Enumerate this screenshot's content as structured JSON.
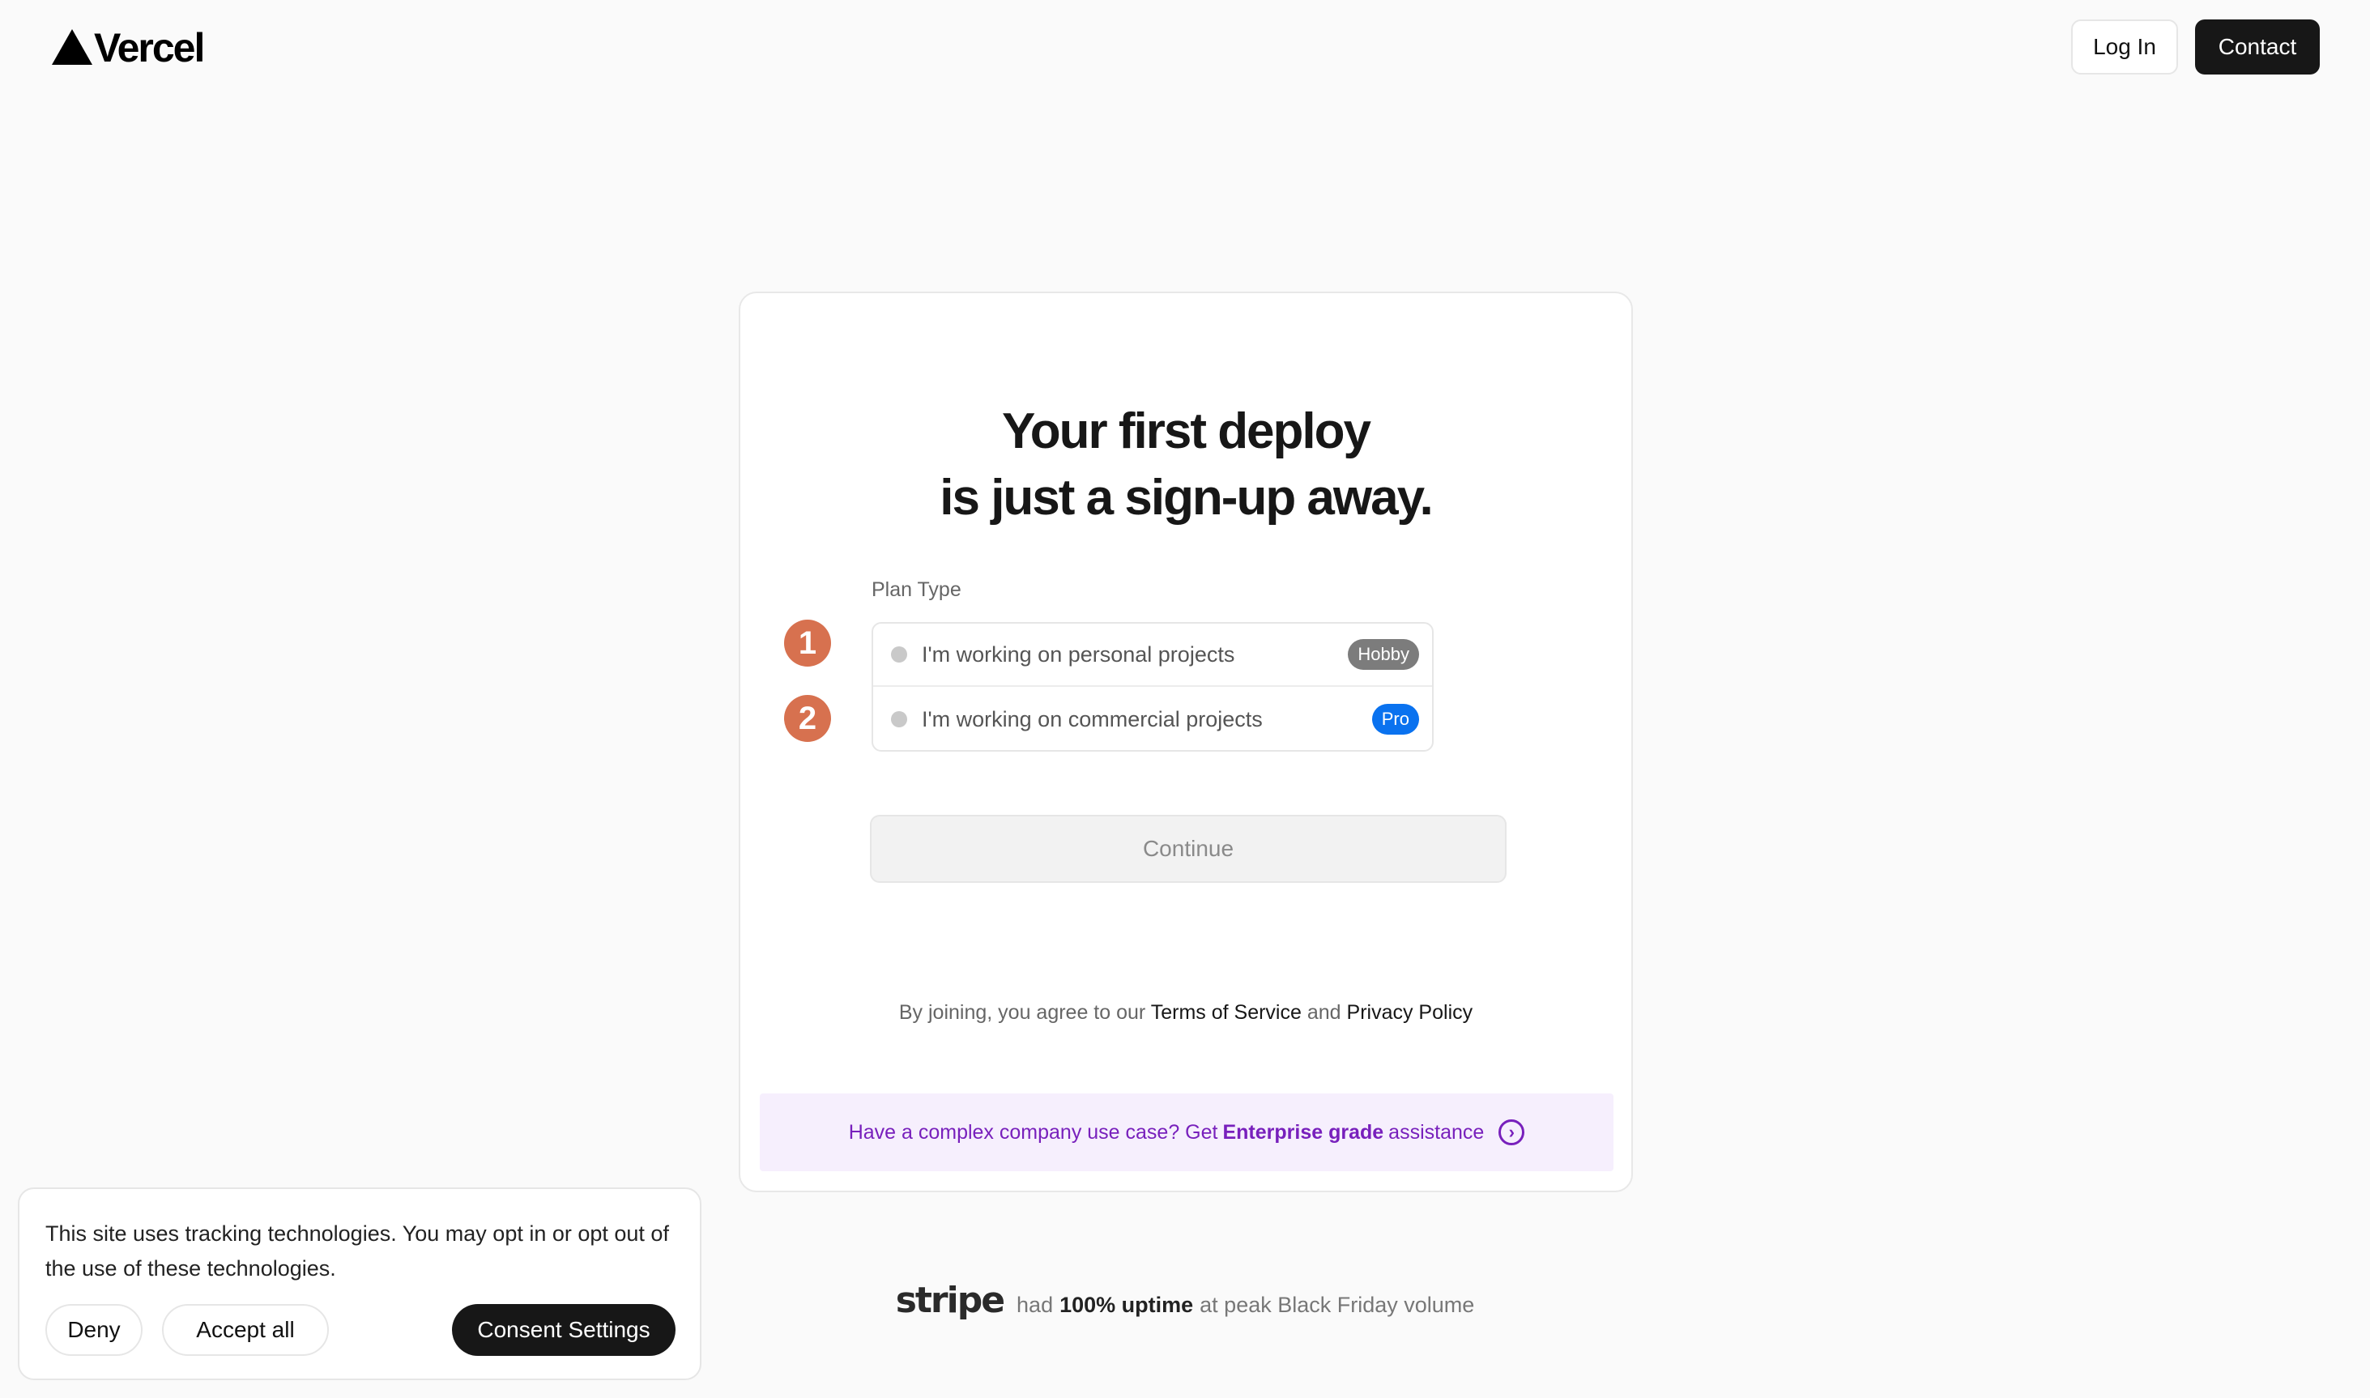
{
  "header": {
    "logo_text": "Vercel",
    "login_label": "Log In",
    "contact_label": "Contact"
  },
  "signup": {
    "headline_line1": "Your first deploy",
    "headline_line2": "is just a sign-up away.",
    "plan_label": "Plan Type",
    "options": [
      {
        "step": "1",
        "text": "I'm working on personal projects",
        "badge": "Hobby"
      },
      {
        "step": "2",
        "text": "I'm working on commercial projects",
        "badge": "Pro"
      }
    ],
    "continue_label": "Continue",
    "legal_prefix": "By joining, you agree to our",
    "terms_label": "Terms of Service",
    "legal_and": "and",
    "privacy_label": "Privacy Policy",
    "enterprise_prefix": "Have a complex company use case? Get",
    "enterprise_bold": "Enterprise grade",
    "enterprise_suffix": "assistance"
  },
  "social_proof": {
    "logo_text": "stripe",
    "text_had": "had",
    "text_bold": "100% uptime",
    "text_rest": "at peak Black Friday volume"
  },
  "cookie_banner": {
    "message": "This site uses tracking technologies. You may opt in or opt out of the use of these technologies.",
    "deny_label": "Deny",
    "accept_label": "Accept all",
    "consent_label": "Consent Settings"
  },
  "colors": {
    "background": "#fafafa",
    "accent_purple": "#7820bc",
    "badge_pro": "#0a72ef",
    "badge_hobby": "#7c7c7c",
    "step_marker": "#d7714f"
  }
}
